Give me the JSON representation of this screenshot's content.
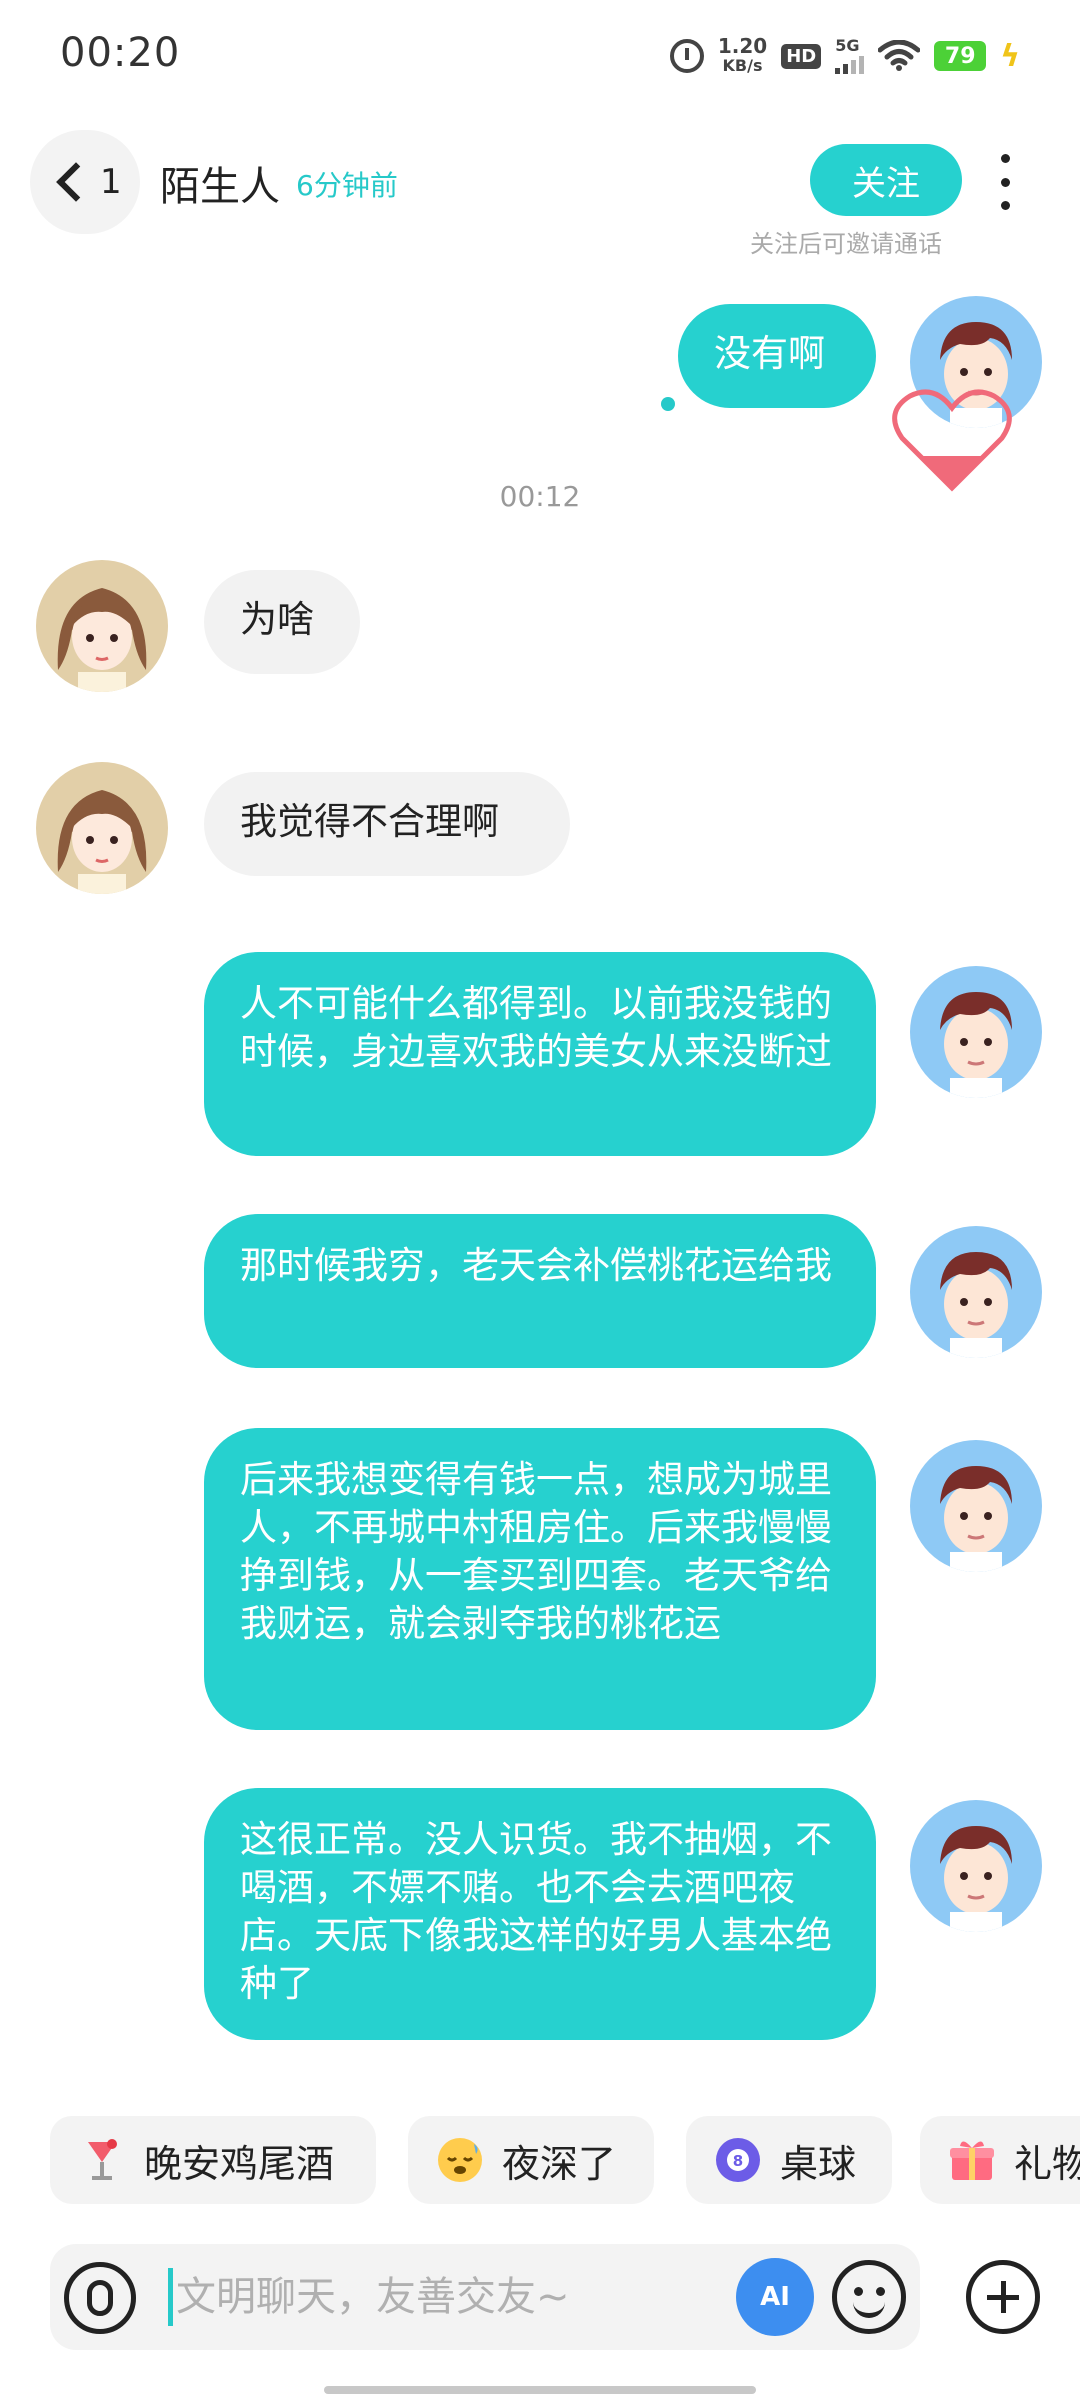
{
  "status_bar": {
    "time": "00:20",
    "net_speed_value": "1.20",
    "net_speed_unit": "KB/s",
    "hd_label": "HD",
    "network_label": "5G",
    "battery": "79"
  },
  "header": {
    "back_count": "1",
    "name": "陌生人",
    "last_seen": "6分钟前",
    "follow_label": "关注",
    "follow_hint": "关注后可邀请通话"
  },
  "colors": {
    "accent": "#26d1cf",
    "their_bubble": "#f2f2f2"
  },
  "messages": [
    {
      "from": "me",
      "text": "没有啊"
    },
    {
      "type": "time",
      "text": "00:12"
    },
    {
      "from": "them",
      "text": "为啥"
    },
    {
      "from": "them",
      "text": "我觉得不合理啊"
    },
    {
      "from": "me",
      "text": "人不可能什么都得到。以前我没钱的时候，身边喜欢我的美女从来没断过"
    },
    {
      "from": "me",
      "text": "那时候我穷，老天会补偿桃花运给我"
    },
    {
      "from": "me",
      "text": "后来我想变得有钱一点，想成为城里人，不再城中村租房住。后来我慢慢挣到钱，从一套买到四套。老天爷给我财运，就会剥夺我的桃花运"
    },
    {
      "from": "me",
      "text": "这很正常。没人识货。我不抽烟，不喝酒，不嫖不赌。也不会去酒吧夜店。天底下像我这样的好男人基本绝种了"
    }
  ],
  "quick_chips": [
    {
      "label": "晚安鸡尾酒",
      "icon": "cocktail-icon"
    },
    {
      "label": "夜深了",
      "icon": "sleepy-face-icon"
    },
    {
      "label": "桌球",
      "icon": "billiard-ball-icon"
    },
    {
      "label": "礼物",
      "icon": "gift-icon"
    }
  ],
  "input": {
    "placeholder": "文明聊天，友善交友~",
    "value": "",
    "ai_label": "AI"
  }
}
